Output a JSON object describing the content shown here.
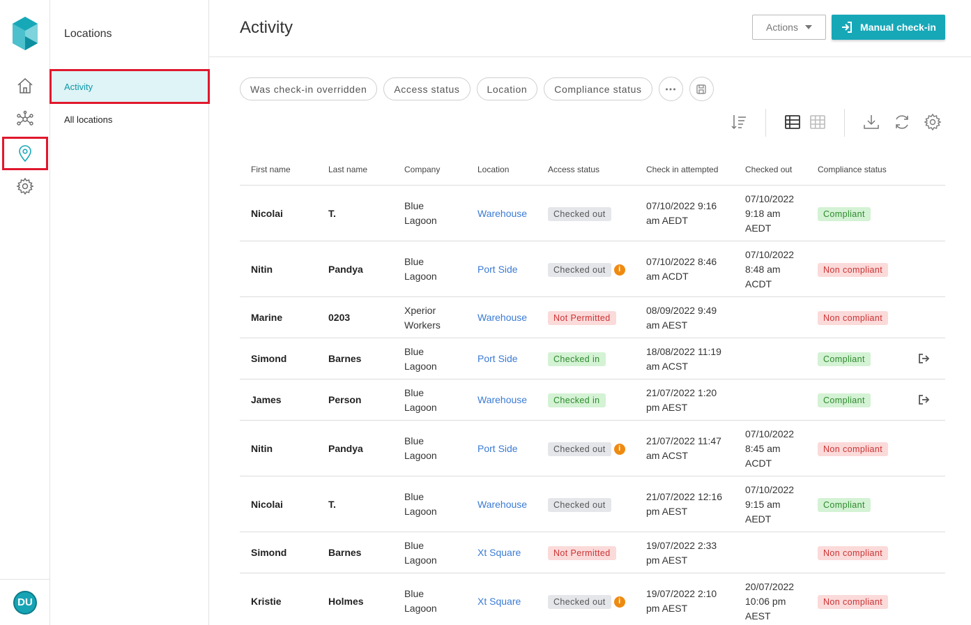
{
  "subnav": {
    "title": "Locations",
    "items": [
      {
        "label": "Activity"
      },
      {
        "label": "All locations"
      }
    ]
  },
  "user": {
    "initials": "DU"
  },
  "header": {
    "title": "Activity",
    "actions_label": "Actions",
    "checkin_label": "Manual check-in"
  },
  "filters": [
    "Was check-in overridden",
    "Access status",
    "Location",
    "Compliance status"
  ],
  "icons": {
    "rail": [
      "home-icon",
      "network-icon",
      "location-pin-icon",
      "gear-icon"
    ],
    "toolbar": [
      "sort-icon",
      "list-view-icon",
      "grid-view-icon",
      "download-icon",
      "refresh-icon",
      "settings-icon"
    ]
  },
  "colors": {
    "accent": "#17a8b8",
    "highlight": "#e0182d"
  },
  "table": {
    "columns": [
      "First name",
      "Last name",
      "Company",
      "Location",
      "Access status",
      "Check in attempted",
      "Checked out",
      "Compliance status"
    ],
    "rows": [
      {
        "first": "Nicolai",
        "last": "T.",
        "company": "Blue Lagoon",
        "location": "Warehouse",
        "access": "Checked out",
        "info": false,
        "checkin": "07/10/2022 9:16 am AEDT",
        "checkout": "07/10/2022 9:18 am AEDT",
        "compliance": "Compliant",
        "action": false
      },
      {
        "first": "Nitin",
        "last": "Pandya",
        "company": "Blue Lagoon",
        "location": "Port Side",
        "access": "Checked out",
        "info": true,
        "checkin": "07/10/2022 8:46 am ACDT",
        "checkout": "07/10/2022 8:48 am ACDT",
        "compliance": "Non compliant",
        "action": false
      },
      {
        "first": "Marine",
        "last": "0203",
        "company": "Xperior Workers",
        "location": "Warehouse",
        "access": "Not Permitted",
        "info": false,
        "checkin": "08/09/2022 9:49 am AEST",
        "checkout": "",
        "compliance": "Non compliant",
        "action": false
      },
      {
        "first": "Simond",
        "last": "Barnes",
        "company": "Blue Lagoon",
        "location": "Port Side",
        "access": "Checked in",
        "info": false,
        "checkin": "18/08/2022 11:19 am ACST",
        "checkout": "",
        "compliance": "Compliant",
        "action": true
      },
      {
        "first": "James",
        "last": "Person",
        "company": "Blue Lagoon",
        "location": "Warehouse",
        "access": "Checked in",
        "info": false,
        "checkin": "21/07/2022 1:20 pm AEST",
        "checkout": "",
        "compliance": "Compliant",
        "action": true
      },
      {
        "first": "Nitin",
        "last": "Pandya",
        "company": "Blue Lagoon",
        "location": "Port Side",
        "access": "Checked out",
        "info": true,
        "checkin": "21/07/2022 11:47 am ACST",
        "checkout": "07/10/2022 8:45 am ACDT",
        "compliance": "Non compliant",
        "action": false
      },
      {
        "first": "Nicolai",
        "last": "T.",
        "company": "Blue Lagoon",
        "location": "Warehouse",
        "access": "Checked out",
        "info": false,
        "checkin": "21/07/2022 12:16 pm AEST",
        "checkout": "07/10/2022 9:15 am AEDT",
        "compliance": "Compliant",
        "action": false
      },
      {
        "first": "Simond",
        "last": "Barnes",
        "company": "Blue Lagoon",
        "location": "Xt Square",
        "access": "Not Permitted",
        "info": false,
        "checkin": "19/07/2022 2:33 pm AEST",
        "checkout": "",
        "compliance": "Non compliant",
        "action": false
      },
      {
        "first": "Kristie",
        "last": "Holmes",
        "company": "Blue Lagoon",
        "location": "Xt Square",
        "access": "Checked out",
        "info": true,
        "checkin": "19/07/2022 2:10 pm AEST",
        "checkout": "20/07/2022 10:06 pm AEST",
        "compliance": "Non compliant",
        "action": false
      }
    ]
  }
}
